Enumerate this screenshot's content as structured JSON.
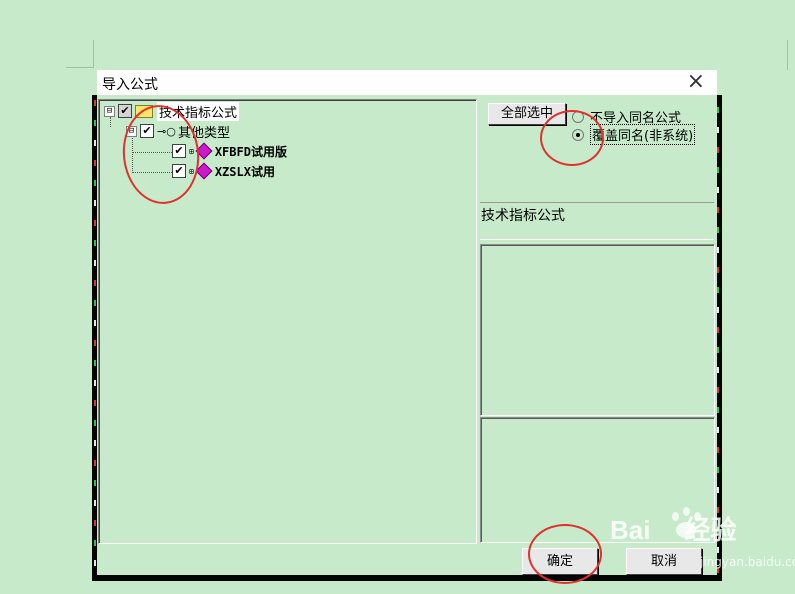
{
  "dialog": {
    "title": "导入公式",
    "close_glyph": "×"
  },
  "tree": {
    "root": {
      "expander": "⊟",
      "label": "技术指标公式",
      "checked": true
    },
    "group": {
      "expander": "⊟",
      "label": "其他类型",
      "checked": true
    },
    "items": [
      {
        "label": "XFBFD试用版",
        "checked": true,
        "icon": "gem-icon"
      },
      {
        "label": "XZSLX试用",
        "checked": true,
        "icon": "gem-icon"
      }
    ]
  },
  "controls": {
    "select_all_label": "全部选中",
    "radio_options": [
      {
        "label": "不导入同名公式",
        "selected": false
      },
      {
        "label": "覆盖同名(非系统)",
        "selected": true
      }
    ]
  },
  "detail": {
    "formula_name": "技术指标公式"
  },
  "buttons": {
    "ok_label": "确定",
    "cancel_label": "取消"
  },
  "watermark": {
    "brand": "Bai",
    "brand_cn": "经验",
    "domain": "jingyan.baidu.com"
  },
  "colors": {
    "background": "#c7eacb",
    "annotation_red": "#e0312c",
    "gem": "#cc19cc"
  }
}
